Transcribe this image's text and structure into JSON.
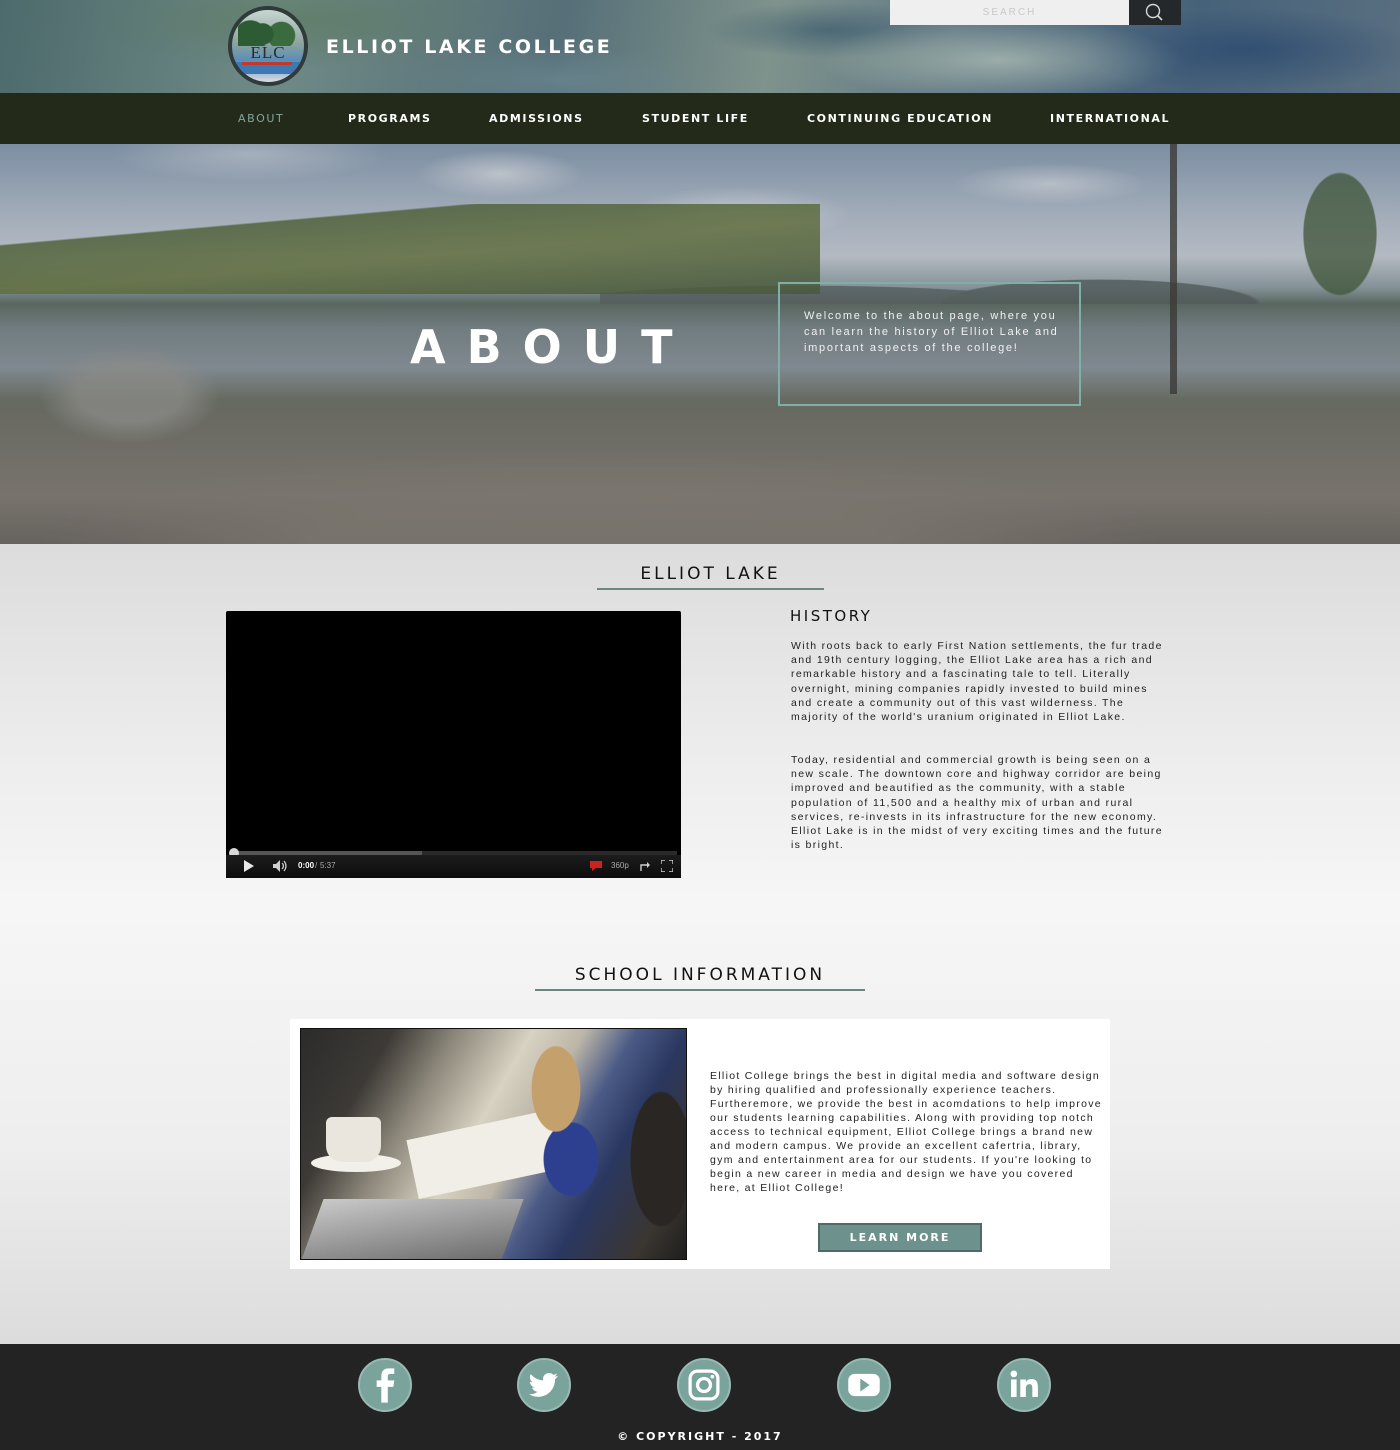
{
  "header": {
    "logo_letters": "ELC",
    "college_name": "ELLIOT LAKE COLLEGE",
    "search_placeholder": "SEARCH"
  },
  "nav": {
    "items": [
      {
        "label": "ABOUT",
        "active": true
      },
      {
        "label": "PROGRAMS",
        "active": false
      },
      {
        "label": "ADMISSIONS",
        "active": false
      },
      {
        "label": "STUDENT LIFE",
        "active": false
      },
      {
        "label": "CONTINUING EDUCATION",
        "active": false
      },
      {
        "label": "INTERNATIONAL",
        "active": false
      }
    ]
  },
  "hero": {
    "title": "ABOUT",
    "welcome_text": "Welcome to the about page, where you can learn the history of Elliot Lake and important aspects of the college!"
  },
  "elliot_lake": {
    "heading": "ELLIOT LAKE",
    "video": {
      "current_time": "0:00",
      "separator": "/",
      "duration": "5:37",
      "quality": "360p",
      "progress_fraction": 0.0,
      "buffered_fraction": 0.43
    },
    "history_title": "HISTORY",
    "paragraph_1": "With roots back to early First Nation settlements, the fur trade and 19th century logging, the Elliot Lake area has a rich and remarkable history and a fascinating tale to tell. Literally overnight, mining companies rapidly invested to build mines and create a community out of this vast wilderness. The majority of the world's uranium originated in Elliot Lake.",
    "paragraph_2": "Today, residential and commercial growth is being seen on a new scale. The downtown core and highway corridor are being improved and beautified as the community, with a stable population of 11,500 and a healthy mix of urban and rural services, re-invests in its infrastructure for the new economy. Elliot Lake is in the midst of very exciting times and the future is bright."
  },
  "school_info": {
    "heading": "SCHOOL INFORMATION",
    "body": "Elliot College brings the best in digital media and software design by hiring qualified and professionally experience teachers. Furtheremore, we provide the best in acomdations to help improve our students learning capabilities. Along with providing top notch access to technical equipment, Elliot College brings a brand new and modern campus. We provide an excellent cafertria, library, gym and entertainment area for our students. If you're looking to begin a new career in media and design we have you covered here, at Elliot College!",
    "button_label": "LEARN MORE"
  },
  "footer": {
    "social_icons": [
      "facebook-icon",
      "twitter-icon",
      "instagram-icon",
      "youtube-icon",
      "linkedin-icon"
    ],
    "copyright": "© COPYRIGHT - 2017"
  },
  "colors": {
    "nav_bg": "#232a1a",
    "accent": "#7fa8a1",
    "button_bg": "#6d918d",
    "footer_bg": "#232323"
  }
}
